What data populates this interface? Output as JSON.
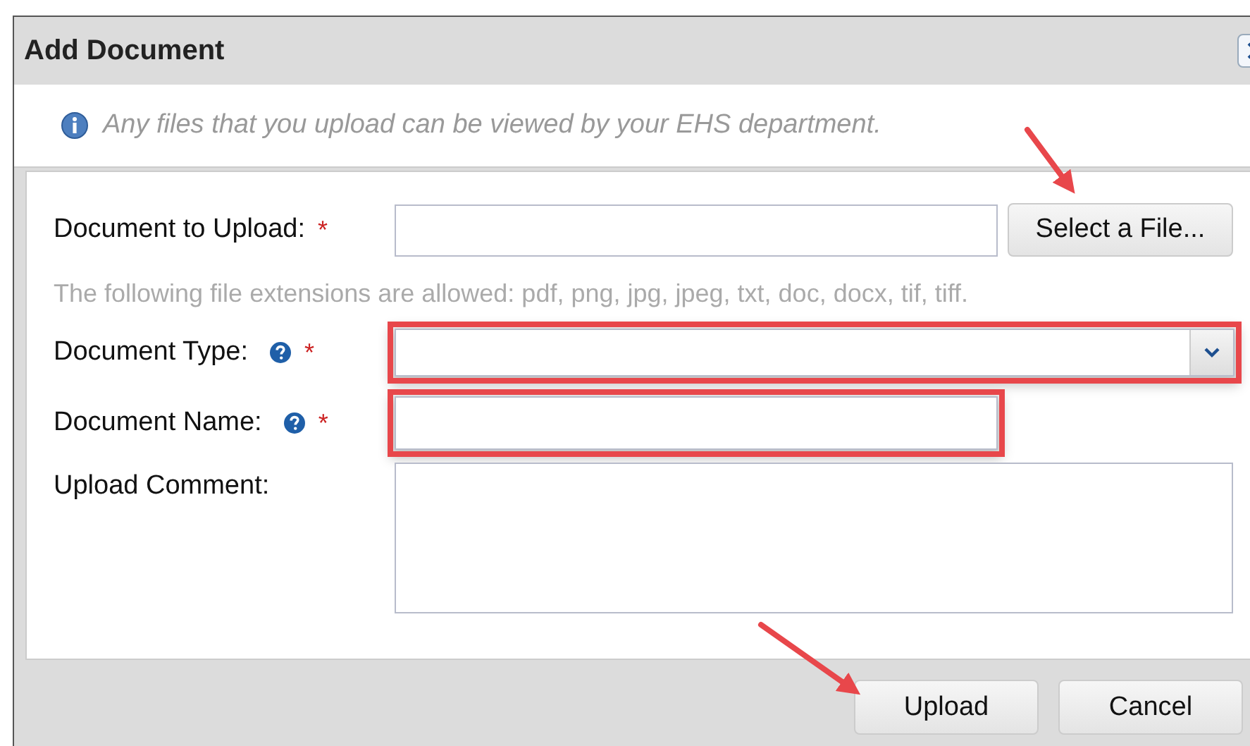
{
  "dialog": {
    "title": "Add Document",
    "info": "Any files that you upload can be viewed by your EHS department."
  },
  "fields": [
    {
      "kind": "file",
      "label": "Document to Upload:",
      "required_mark": "*",
      "help": false,
      "highlighted": false,
      "button": "Select a File..."
    },
    {
      "kind": "hint",
      "text": "The following file extensions are allowed: pdf, png, jpg, jpeg, txt, doc, docx, tif, tiff."
    },
    {
      "kind": "select",
      "label": "Document Type:",
      "required_mark": "*",
      "help": true,
      "highlighted": true
    },
    {
      "kind": "text",
      "label": "Document Name:",
      "required_mark": "*",
      "help": true,
      "highlighted": true
    },
    {
      "kind": "textarea",
      "label": "Upload Comment:",
      "help": false,
      "highlighted": false
    }
  ],
  "buttons": [
    "Upload",
    "Cancel"
  ]
}
